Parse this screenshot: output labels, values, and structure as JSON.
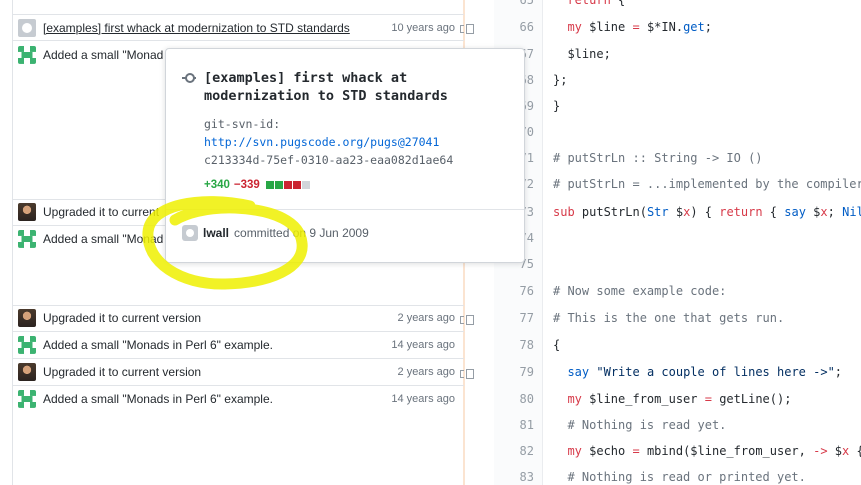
{
  "blame": [
    {
      "avatar": "github-avatar",
      "message": "[examples] first whack at modernization to STD standards",
      "age": "10 years ago",
      "link": true
    },
    {
      "avatar": "identicon-avatar",
      "message": "Added a small \"Monad",
      "age": "",
      "link": false
    },
    {
      "avatar": "photo-avatar",
      "message": "Upgraded it to current",
      "age": "",
      "link": false
    },
    {
      "avatar": "identicon-avatar",
      "message": "Added a small \"Monad",
      "age": "",
      "link": false
    },
    {
      "avatar": "photo-avatar",
      "message": "Upgraded it to current version",
      "age": "2 years ago",
      "link": false
    },
    {
      "avatar": "identicon-avatar",
      "message": "Added a small \"Monads in Perl 6\" example.",
      "age": "14 years ago",
      "link": false
    },
    {
      "avatar": "photo-avatar",
      "message": "Upgraded it to current version",
      "age": "2 years ago",
      "link": false
    },
    {
      "avatar": "identicon-avatar",
      "message": "Added a small \"Monads in Perl 6\" example.",
      "age": "14 years ago",
      "link": false
    }
  ],
  "lines": [
    {
      "num": "65",
      "code": "  return {"
    },
    {
      "num": "66",
      "code": "  my $line = $*IN.get;"
    },
    {
      "num": "67",
      "code": "  $line;"
    },
    {
      "num": "68",
      "code": "};"
    },
    {
      "num": "69",
      "code": "}"
    },
    {
      "num": "70",
      "code": ""
    },
    {
      "num": "71",
      "code": "# putStrLn :: String -> IO ()"
    },
    {
      "num": "72",
      "code": "# putStrLn = ...implemented by the compiler."
    },
    {
      "num": "73",
      "code": "sub putStrLn(Str $x) { return { say $x; Nil"
    },
    {
      "num": "74",
      "code": ""
    },
    {
      "num": "75",
      "code": ""
    },
    {
      "num": "76",
      "code": "# Now some example code:"
    },
    {
      "num": "77",
      "code": "# This is the one that gets run."
    },
    {
      "num": "78",
      "code": "{"
    },
    {
      "num": "79",
      "code": "  say \"Write a couple of lines here ->\";"
    },
    {
      "num": "80",
      "code": "  my $line_from_user = getLine();"
    },
    {
      "num": "81",
      "code": "  # Nothing is read yet."
    },
    {
      "num": "82",
      "code": "  my $echo = mbind($line_from_user, -> $x {"
    },
    {
      "num": "83",
      "code": "  # Nothing is read or printed yet."
    }
  ],
  "popover": {
    "title": "[examples] first whack at modernization to STD standards",
    "body_prefix": "git-svn-id: ",
    "svn_link": "http://svn.pugscode.org/pugs@27041",
    "body_suffix": " c213334d-75ef-0310-aa23-eaa082d1ae64",
    "additions": "+340",
    "deletions": "−339",
    "author": "lwall",
    "committed_text": " committed on 9 Jun 2009"
  },
  "colors": {
    "addition": "#28a745",
    "deletion": "#cb2431",
    "highlight": "#f3f000"
  }
}
